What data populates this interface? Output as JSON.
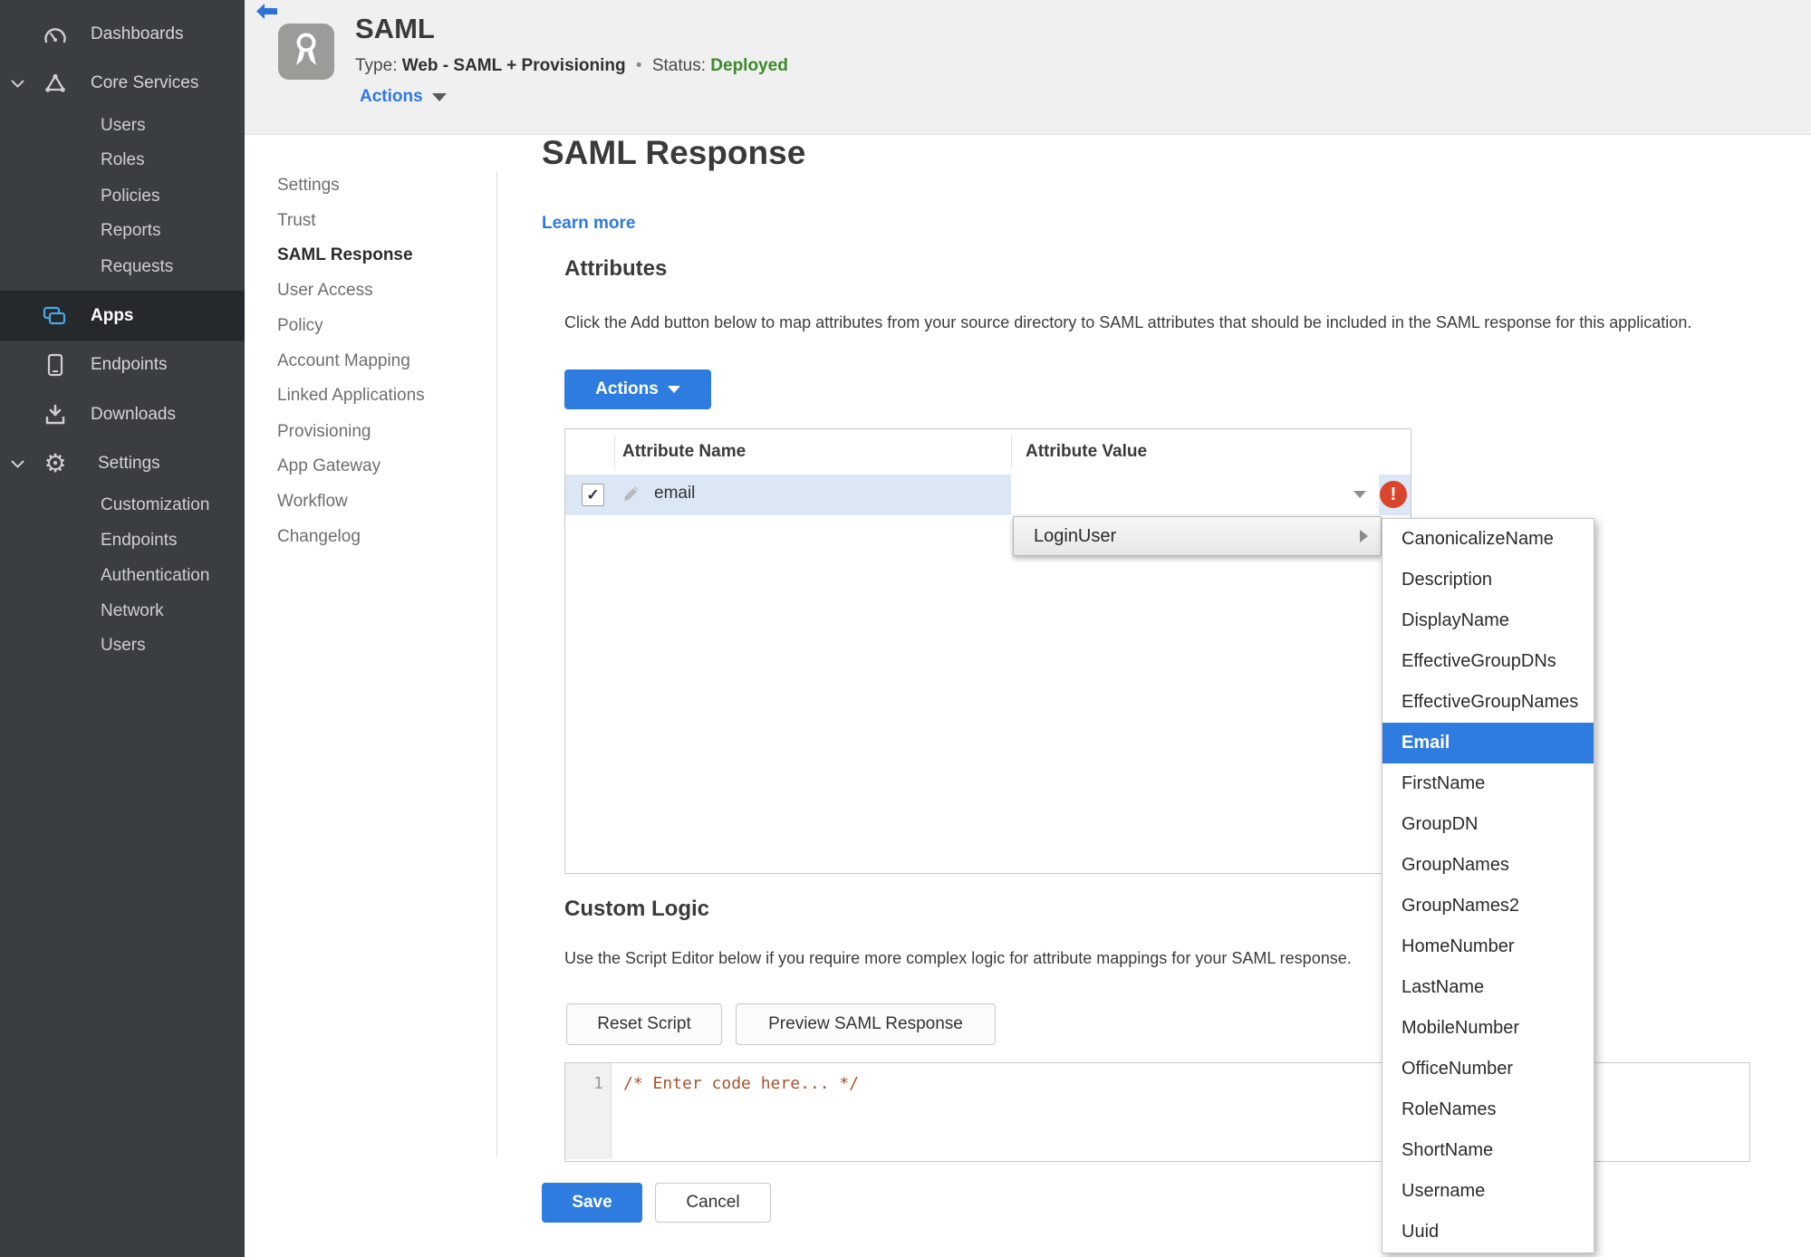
{
  "sidebar": {
    "items": [
      {
        "label": "Dashboards"
      },
      {
        "label": "Core Services"
      },
      {
        "label": "Users"
      },
      {
        "label": "Roles"
      },
      {
        "label": "Policies"
      },
      {
        "label": "Reports"
      },
      {
        "label": "Requests"
      },
      {
        "label": "Apps"
      },
      {
        "label": "Endpoints"
      },
      {
        "label": "Downloads"
      },
      {
        "label": "Settings"
      },
      {
        "label": "Customization"
      },
      {
        "label": "Endpoints"
      },
      {
        "label": "Authentication"
      },
      {
        "label": "Network"
      },
      {
        "label": "Users"
      }
    ]
  },
  "header": {
    "app_name": "SAML",
    "type_label": "Type:",
    "type_value": "Web - SAML + Provisioning",
    "separator": "•",
    "status_label": "Status:",
    "status_value": "Deployed",
    "actions_label": "Actions"
  },
  "subnav": {
    "items": [
      "Settings",
      "Trust",
      "SAML Response",
      "User Access",
      "Policy",
      "Account Mapping",
      "Linked Applications",
      "Provisioning",
      "App Gateway",
      "Workflow",
      "Changelog"
    ],
    "active": "SAML Response"
  },
  "main": {
    "title": "SAML Response",
    "learn_more": "Learn more",
    "attributes": {
      "heading": "Attributes",
      "description": "Click the Add button below to map attributes from your source directory to SAML attributes that should be included in the SAML response for this application.",
      "actions_button": "Actions",
      "table": {
        "columns": [
          "Attribute Name",
          "Attribute Value"
        ],
        "rows": [
          {
            "checked": true,
            "name": "email",
            "value": "",
            "error": true
          }
        ]
      }
    },
    "value_menu": {
      "parent": "LoginUser",
      "selected": "Email",
      "options": [
        "CanonicalizeName",
        "Description",
        "DisplayName",
        "EffectiveGroupDNs",
        "EffectiveGroupNames",
        "Email",
        "FirstName",
        "GroupDN",
        "GroupNames",
        "GroupNames2",
        "HomeNumber",
        "LastName",
        "MobileNumber",
        "OfficeNumber",
        "RoleNames",
        "ShortName",
        "Username",
        "Uuid"
      ]
    },
    "custom_logic": {
      "heading": "Custom Logic",
      "description": "Use the Script Editor below if you require more complex logic for attribute mappings for your SAML response.",
      "reset_button": "Reset Script",
      "preview_button": "Preview SAML Response",
      "editor": {
        "line_number": "1",
        "code": "/* Enter code here... */"
      }
    },
    "save_button": "Save",
    "cancel_button": "Cancel"
  },
  "glyphs": {
    "checkmark": "✓",
    "exclamation": "!",
    "gear": "⚙"
  },
  "colors": {
    "accent_blue": "#2e7ce0",
    "status_green": "#3c8a27",
    "error_red": "#d9452c",
    "sidebar_bg": "#3a3e41",
    "apps_icon_cyan": "#4aa9e8",
    "row_highlight": "#dbe7f4",
    "code_comment": "#a5532b"
  }
}
